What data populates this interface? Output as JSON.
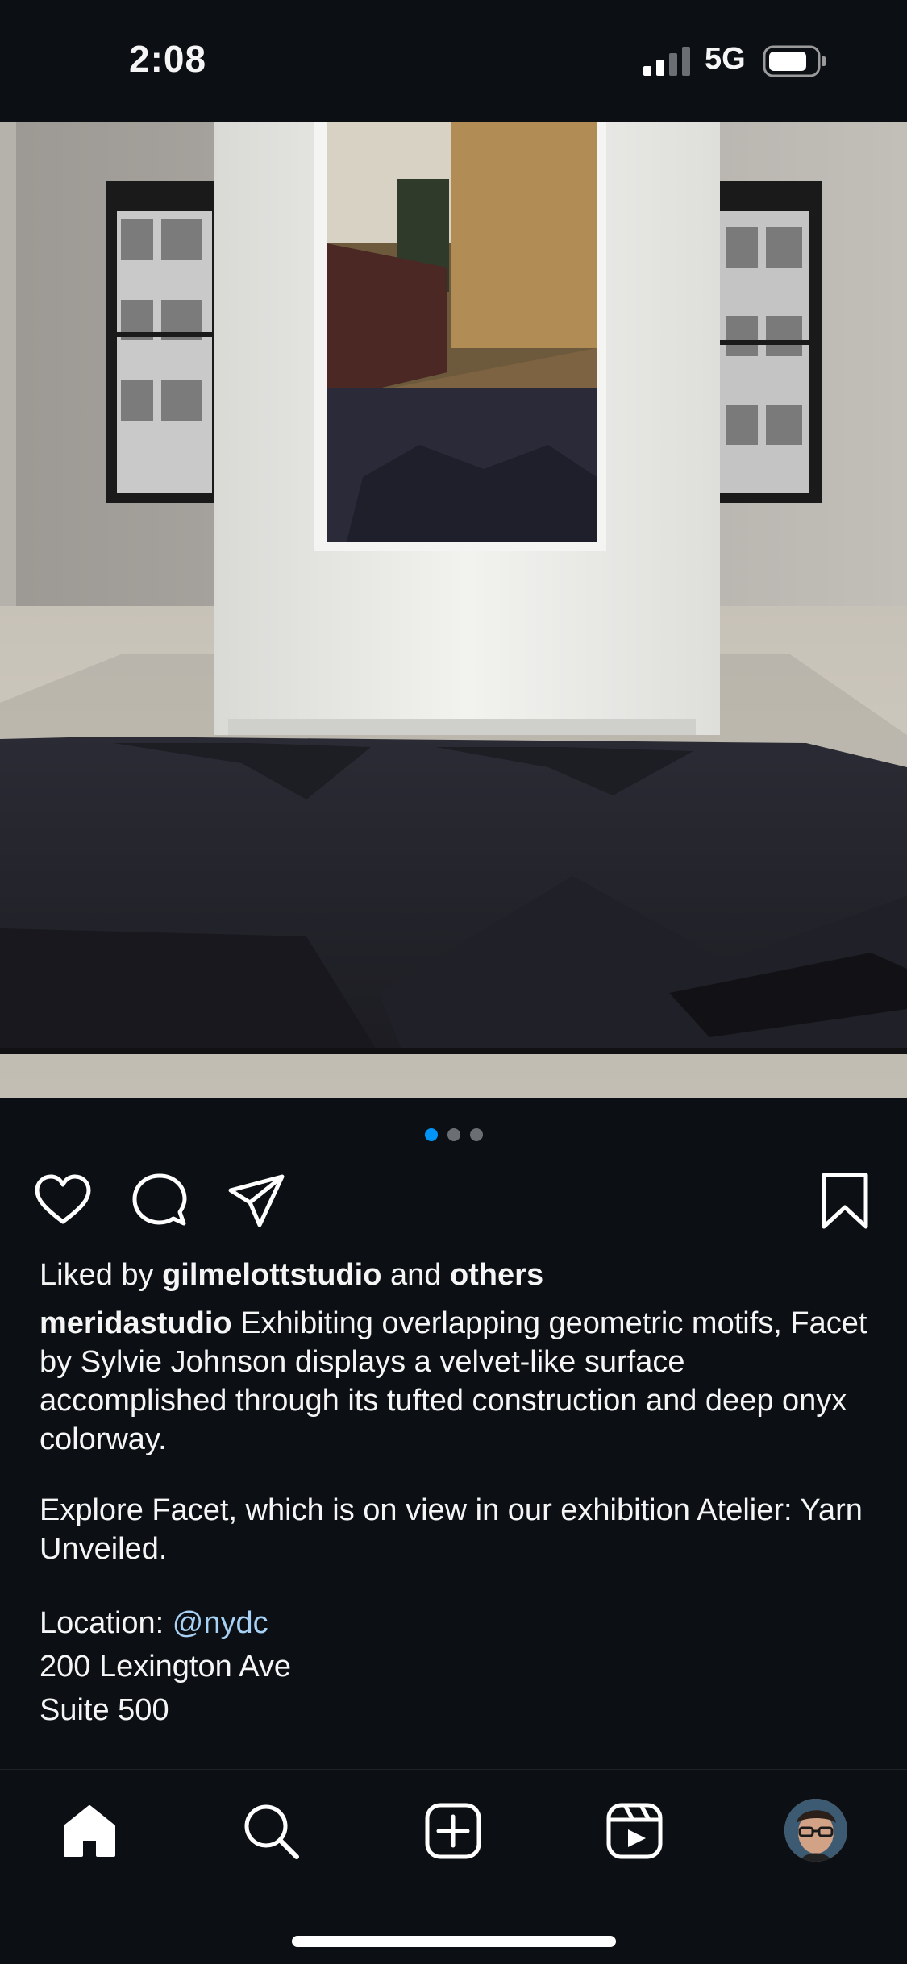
{
  "status_bar": {
    "time": "2:08",
    "network": "5G",
    "signal_icon": "cellular-signal-icon",
    "battery_icon": "battery-icon"
  },
  "post": {
    "image_description_icon": "gallery-carpet-photo",
    "carousel": {
      "count": 3,
      "active_index": 0
    },
    "actions": {
      "like_icon": "heart-icon",
      "comment_icon": "comment-icon",
      "share_icon": "send-icon",
      "save_icon": "bookmark-icon"
    },
    "likes": {
      "prefix": "Liked by ",
      "user": "gilmelottstudio",
      "and": " and ",
      "others": "others"
    },
    "caption": {
      "username": "meridastudio",
      "text": " Exhibiting overlapping geometric motifs, Facet by Sylvie Johnson displays a velvet-like surface accomplished through its tufted construction and deep onyx colorway.",
      "para2": "Explore Facet, which is on view in our exhibition Atelier: Yarn Unveiled.",
      "location_label": "Location: ",
      "location_mention": "@nydc",
      "address_line1": "200 Lexington Ave",
      "address_line2": "Suite 500"
    }
  },
  "bottom_nav": {
    "items": [
      "home-icon",
      "search-icon",
      "new-post-icon",
      "reels-icon",
      "profile-avatar"
    ]
  },
  "colors": {
    "background": "#0c1014",
    "text": "#f5f5f5",
    "accent": "#0095f6",
    "mention": "#a8d2f5"
  }
}
